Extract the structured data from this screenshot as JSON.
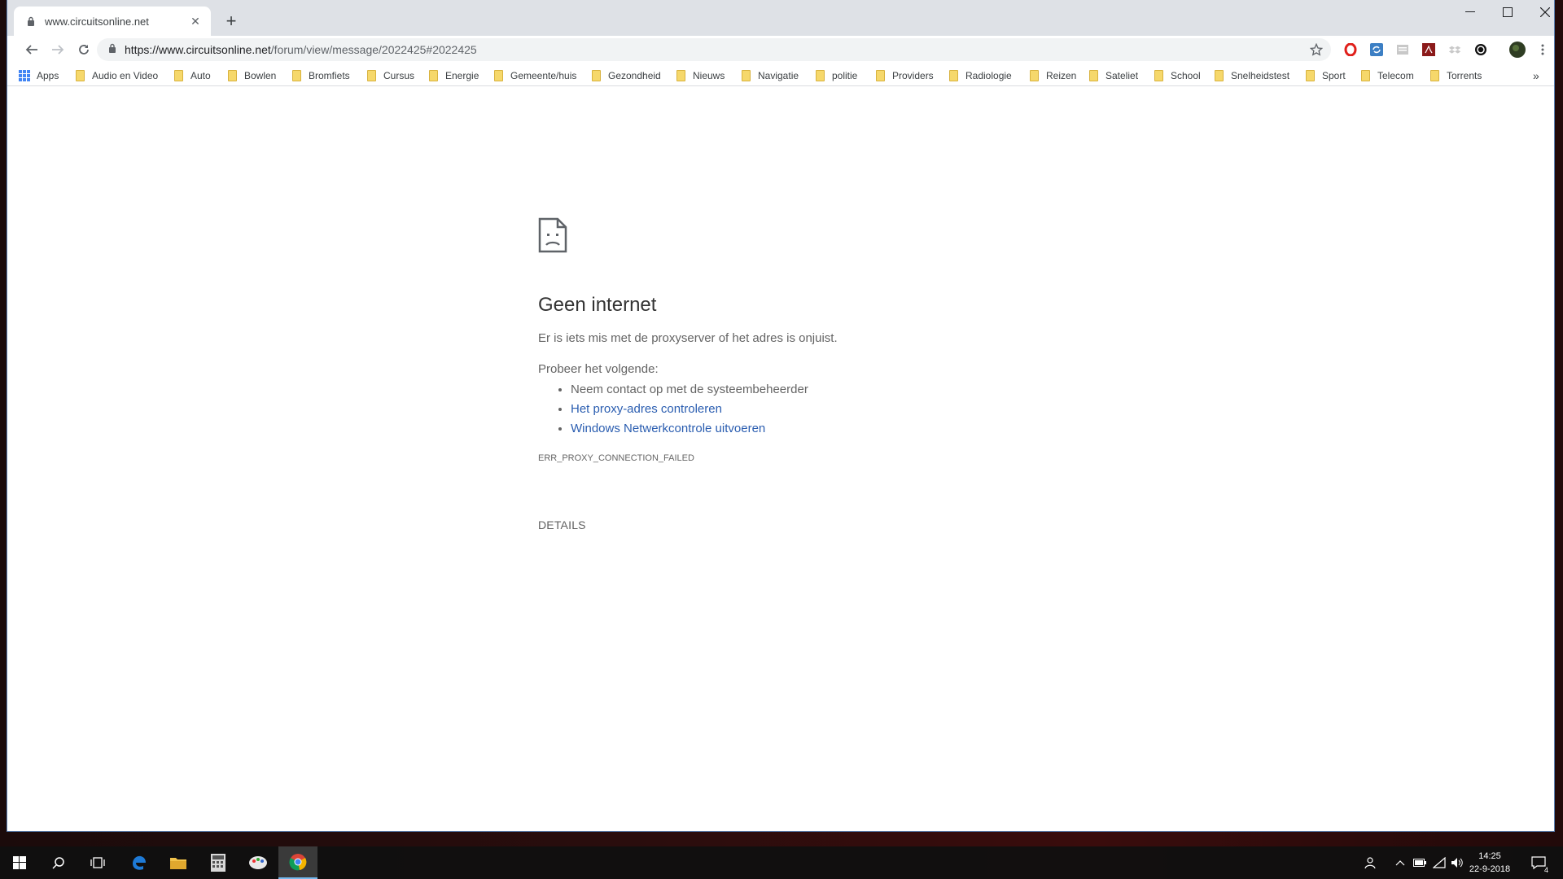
{
  "tab": {
    "title": "www.circuitsonline.net",
    "new_tab": "+"
  },
  "window": {
    "minimize": "—",
    "maximize": "☐",
    "close": "✕"
  },
  "toolbar": {
    "url_host": "https://www.circuitsonline.net",
    "url_path": "/forum/view/message/2022425#2022425"
  },
  "bookmarks": {
    "apps": "Apps",
    "items": [
      "Audio en Video",
      "Auto",
      "Bowlen",
      "Bromfiets",
      "Cursus",
      "Energie",
      "Gemeente/huis",
      "Gezondheid",
      "Nieuws",
      "Navigatie",
      "politie",
      "Providers",
      "Radiologie",
      "Reizen",
      "Sateliet",
      "School",
      "Snelheidstest",
      "Sport",
      "Telecom",
      "Torrents"
    ],
    "overflow": "»"
  },
  "error": {
    "heading": "Geen internet",
    "message": "Er is iets mis met de proxyserver of het adres is onjuist.",
    "suggestions_heading": "Probeer het volgende:",
    "suggestions": [
      "Neem contact op met de systeembeheerder",
      "Het proxy-adres controleren",
      "Windows Netwerkcontrole uitvoeren"
    ],
    "code": "ERR_PROXY_CONNECTION_FAILED",
    "details": "DETAILS"
  },
  "taskbar": {
    "time": "14:25",
    "date": "22-9-2018",
    "notifications": "4"
  },
  "colors": {
    "link": "#2a5db0",
    "accent": "#4285f4"
  }
}
